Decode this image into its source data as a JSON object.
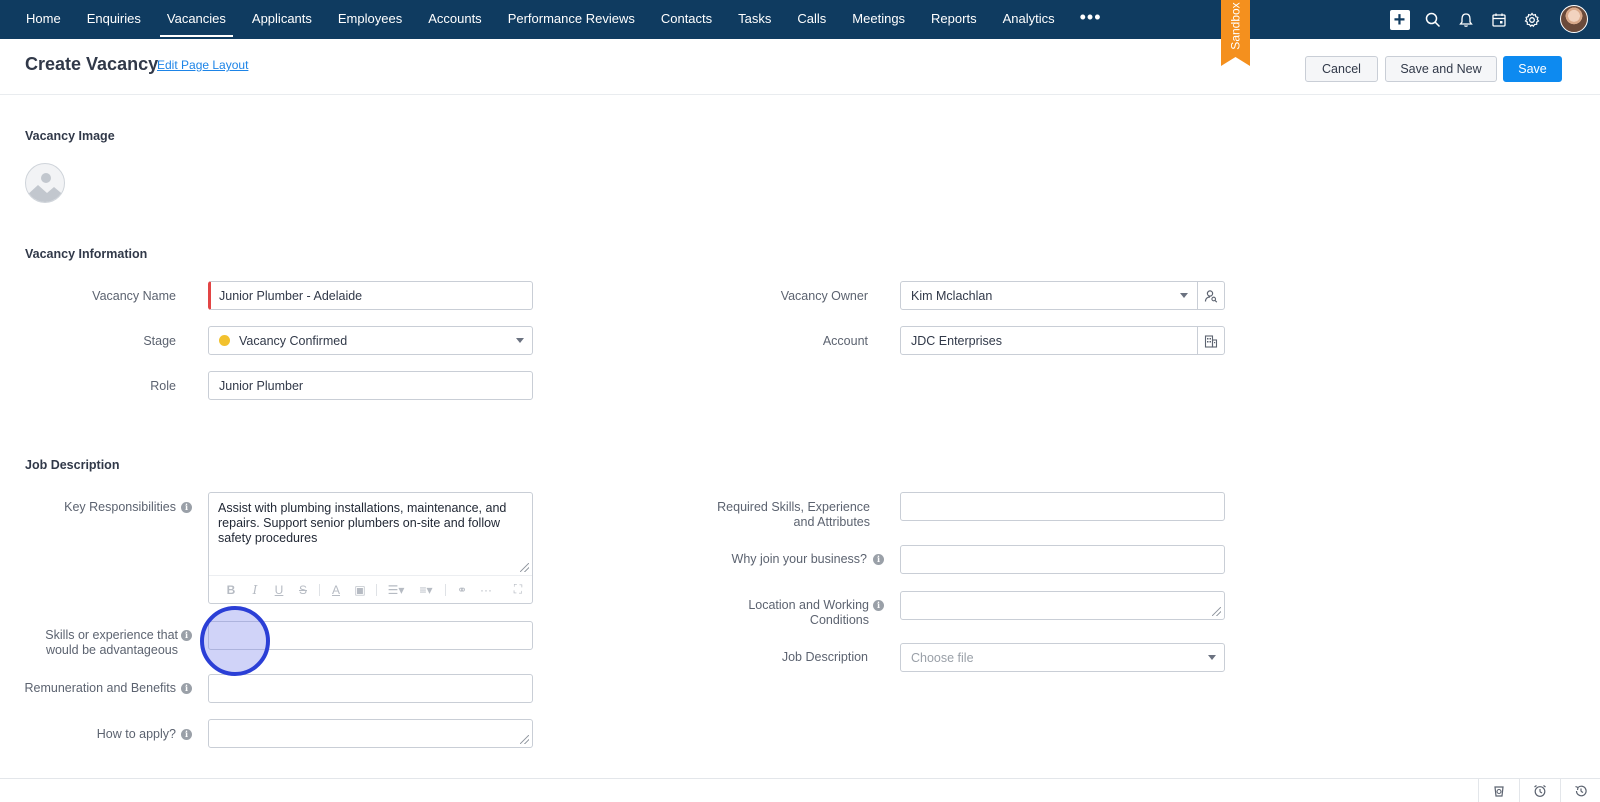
{
  "nav": {
    "items": [
      {
        "label": "Home"
      },
      {
        "label": "Enquiries"
      },
      {
        "label": "Vacancies",
        "active": true
      },
      {
        "label": "Applicants"
      },
      {
        "label": "Employees"
      },
      {
        "label": "Accounts"
      },
      {
        "label": "Performance Reviews"
      },
      {
        "label": "Contacts"
      },
      {
        "label": "Tasks"
      },
      {
        "label": "Calls"
      },
      {
        "label": "Meetings"
      },
      {
        "label": "Reports"
      },
      {
        "label": "Analytics"
      }
    ],
    "more_icon": "ellipsis-icon",
    "sandbox_label": "Sandbox",
    "sandbox_color": "#f4901e",
    "icons": [
      "plus-icon",
      "search-icon",
      "bell-icon",
      "calendar-icon",
      "gear-icon"
    ],
    "bar_color": "#0f3b60"
  },
  "header": {
    "title": "Create Vacancy",
    "edit_layout_link": "Edit Page Layout",
    "cancel_label": "Cancel",
    "save_and_new_label": "Save and New",
    "save_label": "Save",
    "accent_color": "#0d8af0"
  },
  "image_section": {
    "title": "Vacancy Image"
  },
  "vacancy_info": {
    "title": "Vacancy Information",
    "vacancy_name_label": "Vacancy Name",
    "vacancy_name_value": "Junior Plumber - Adelaide",
    "stage_label": "Stage",
    "stage_value": "Vacancy Confirmed",
    "stage_color": "#f2c12e",
    "role_label": "Role",
    "role_value": "Junior Plumber",
    "owner_label": "Vacancy Owner",
    "owner_value": "Kim Mclachlan",
    "account_label": "Account",
    "account_value": "JDC Enterprises"
  },
  "job_description": {
    "title": "Job Description",
    "key_responsibilities_label": "Key Responsibilities",
    "key_responsibilities_value": "Assist with plumbing installations, maintenance, and repairs. Support senior plumbers on-site and follow safety procedures",
    "skills_label_line1": "Skills or experience that",
    "skills_label_line2": "would be advantageous",
    "skills_value": "",
    "remuneration_label": "Remuneration and Benefits",
    "remuneration_value": "",
    "how_to_apply_label": "How to apply?",
    "how_to_apply_value": "",
    "required_skills_label_line1": "Required Skills, Experience",
    "required_skills_label_line2": "and Attributes",
    "required_skills_value": "",
    "why_join_label": "Why join your business?",
    "why_join_value": "",
    "location_label_line1": "Location and Working",
    "location_label_line2": "Conditions",
    "location_value": "",
    "job_description_label": "Job Description",
    "job_description_placeholder": "Choose file"
  },
  "bottom_bar": {
    "icons": [
      "history-icon",
      "alarm-clock-icon",
      "recent-items-icon"
    ]
  }
}
